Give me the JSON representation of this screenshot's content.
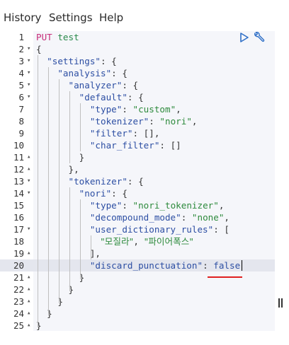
{
  "menu": {
    "items": [
      "History",
      "Settings",
      "Help"
    ]
  },
  "toolbar": {
    "run_icon": "play-triangle-icon",
    "settings_icon": "wrench-icon"
  },
  "editor": {
    "active_line": 20,
    "lines": [
      {
        "n": "1",
        "fold": "",
        "tokens": [
          [
            "kw",
            "PUT"
          ],
          [
            "p",
            " "
          ],
          [
            "url",
            "test"
          ]
        ]
      },
      {
        "n": "2",
        "fold": "▾",
        "tokens": [
          [
            "p",
            "{"
          ]
        ]
      },
      {
        "n": "3",
        "fold": "▾",
        "tokens": [
          [
            "p",
            "  "
          ],
          [
            "key",
            "\"settings\""
          ],
          [
            "p",
            ": {"
          ]
        ]
      },
      {
        "n": "4",
        "fold": "▾",
        "tokens": [
          [
            "p",
            "    "
          ],
          [
            "key",
            "\"analysis\""
          ],
          [
            "p",
            ": {"
          ]
        ]
      },
      {
        "n": "5",
        "fold": "▾",
        "tokens": [
          [
            "p",
            "      "
          ],
          [
            "key",
            "\"analyzer\""
          ],
          [
            "p",
            ": {"
          ]
        ]
      },
      {
        "n": "6",
        "fold": "▾",
        "tokens": [
          [
            "p",
            "        "
          ],
          [
            "key",
            "\"default\""
          ],
          [
            "p",
            ": {"
          ]
        ]
      },
      {
        "n": "7",
        "fold": "",
        "tokens": [
          [
            "p",
            "          "
          ],
          [
            "key",
            "\"type\""
          ],
          [
            "p",
            ": "
          ],
          [
            "str",
            "\"custom\""
          ],
          [
            "p",
            ","
          ]
        ]
      },
      {
        "n": "8",
        "fold": "",
        "tokens": [
          [
            "p",
            "          "
          ],
          [
            "key",
            "\"tokenizer\""
          ],
          [
            "p",
            ": "
          ],
          [
            "str",
            "\"nori\""
          ],
          [
            "p",
            ","
          ]
        ]
      },
      {
        "n": "9",
        "fold": "",
        "tokens": [
          [
            "p",
            "          "
          ],
          [
            "key",
            "\"filter\""
          ],
          [
            "p",
            ": [],"
          ]
        ]
      },
      {
        "n": "10",
        "fold": "",
        "tokens": [
          [
            "p",
            "          "
          ],
          [
            "key",
            "\"char_filter\""
          ],
          [
            "p",
            ": []"
          ]
        ]
      },
      {
        "n": "11",
        "fold": "▴",
        "tokens": [
          [
            "p",
            "        }"
          ]
        ]
      },
      {
        "n": "12",
        "fold": "▴",
        "tokens": [
          [
            "p",
            "      },"
          ]
        ]
      },
      {
        "n": "13",
        "fold": "▾",
        "tokens": [
          [
            "p",
            "      "
          ],
          [
            "key",
            "\"tokenizer\""
          ],
          [
            "p",
            ": {"
          ]
        ]
      },
      {
        "n": "14",
        "fold": "▾",
        "tokens": [
          [
            "p",
            "        "
          ],
          [
            "key",
            "\"nori\""
          ],
          [
            "p",
            ": {"
          ]
        ]
      },
      {
        "n": "15",
        "fold": "",
        "tokens": [
          [
            "p",
            "          "
          ],
          [
            "key",
            "\"type\""
          ],
          [
            "p",
            ": "
          ],
          [
            "str",
            "\"nori_tokenizer\""
          ],
          [
            "p",
            ","
          ]
        ]
      },
      {
        "n": "16",
        "fold": "",
        "tokens": [
          [
            "p",
            "          "
          ],
          [
            "key",
            "\"decompound_mode\""
          ],
          [
            "p",
            ": "
          ],
          [
            "str",
            "\"none\""
          ],
          [
            "p",
            ","
          ]
        ]
      },
      {
        "n": "17",
        "fold": "▾",
        "tokens": [
          [
            "p",
            "          "
          ],
          [
            "key",
            "\"user_dictionary_rules\""
          ],
          [
            "p",
            ": ["
          ]
        ]
      },
      {
        "n": "18",
        "fold": "",
        "tokens": [
          [
            "p",
            "            "
          ],
          [
            "ko",
            "\"모질라\""
          ],
          [
            "p",
            ", "
          ],
          [
            "ko",
            "\"파이어폭스\""
          ]
        ]
      },
      {
        "n": "19",
        "fold": "▴",
        "tokens": [
          [
            "p",
            "          ],"
          ]
        ]
      },
      {
        "n": "20",
        "fold": "",
        "tokens": [
          [
            "p",
            "          "
          ],
          [
            "key",
            "\"discard_punctuation\""
          ],
          [
            "p",
            ": "
          ],
          [
            "bool",
            "false"
          ]
        ]
      },
      {
        "n": "21",
        "fold": "▴",
        "tokens": [
          [
            "p",
            "        }"
          ]
        ]
      },
      {
        "n": "22",
        "fold": "▴",
        "tokens": [
          [
            "p",
            "      }"
          ]
        ]
      },
      {
        "n": "23",
        "fold": "▴",
        "tokens": [
          [
            "p",
            "    }"
          ]
        ]
      },
      {
        "n": "24",
        "fold": "▴",
        "tokens": [
          [
            "p",
            "  }"
          ]
        ]
      },
      {
        "n": "25",
        "fold": "▴",
        "tokens": [
          [
            "p",
            "}"
          ]
        ]
      }
    ]
  },
  "colors": {
    "editor_bg": "#f5f6fa",
    "active_line_bg": "#e4e6ee",
    "method": "#c62e7a",
    "key": "#2c4ea3",
    "string": "#2d8a3c",
    "annotation_underline": "#e02020"
  }
}
